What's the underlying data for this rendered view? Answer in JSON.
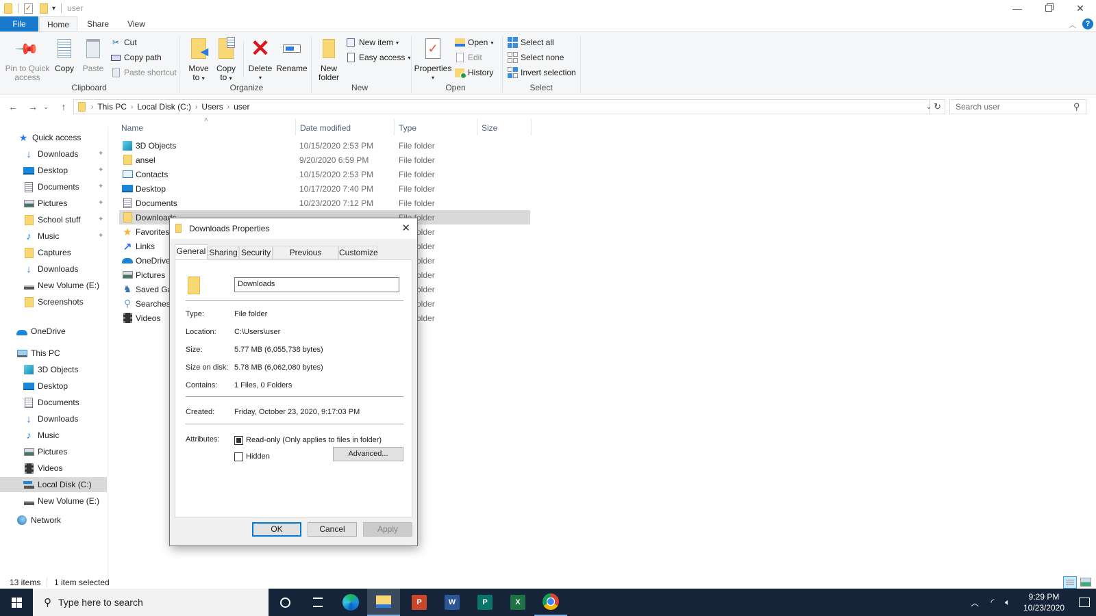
{
  "window": {
    "title": "user",
    "minimize_icon": "minimize-icon",
    "maximize_icon": "restore-icon",
    "close_icon": "close-icon"
  },
  "ribbon_tabs": [
    "File",
    "Home",
    "Share",
    "View"
  ],
  "ribbon": {
    "clipboard": {
      "label": "Clipboard",
      "pin": "Pin to Quick access",
      "pin_line1": "Pin to Quick",
      "pin_line2": "access",
      "copy": "Copy",
      "paste": "Paste",
      "cut": "Cut",
      "copy_path": "Copy path",
      "paste_shortcut": "Paste shortcut"
    },
    "organize": {
      "label": "Organize",
      "move_to_line1": "Move",
      "move_to_line2": "to",
      "copy_to_line1": "Copy",
      "copy_to_line2": "to",
      "delete": "Delete",
      "rename": "Rename"
    },
    "new": {
      "label": "New",
      "new_folder_line1": "New",
      "new_folder_line2": "folder",
      "new_item": "New item",
      "easy_access": "Easy access"
    },
    "open": {
      "label": "Open",
      "properties": "Properties",
      "open": "Open",
      "edit": "Edit",
      "history": "History"
    },
    "select": {
      "label": "Select",
      "select_all": "Select all",
      "select_none": "Select none",
      "invert_selection": "Invert selection"
    }
  },
  "address": {
    "crumbs": [
      "This PC",
      "Local Disk (C:)",
      "Users",
      "user"
    ],
    "search_placeholder": "Search user"
  },
  "sidebar": {
    "quick_access": "Quick access",
    "quick_items": [
      {
        "label": "Downloads",
        "icon": "download-arrow-icon",
        "pinned": true
      },
      {
        "label": "Desktop",
        "icon": "desktop-icon",
        "pinned": true
      },
      {
        "label": "Documents",
        "icon": "documents-icon",
        "pinned": true
      },
      {
        "label": "Pictures",
        "icon": "pictures-icon",
        "pinned": true
      },
      {
        "label": "School stuff",
        "icon": "folder-icon",
        "pinned": true
      },
      {
        "label": "Music",
        "icon": "music-icon",
        "pinned": true
      },
      {
        "label": "Captures",
        "icon": "folder-icon",
        "pinned": false
      },
      {
        "label": "Downloads",
        "icon": "download-arrow-icon",
        "pinned": false
      },
      {
        "label": "New Volume (E:)",
        "icon": "drive-icon",
        "pinned": false
      },
      {
        "label": "Screenshots",
        "icon": "folder-icon",
        "pinned": false
      }
    ],
    "onedrive": "OneDrive",
    "this_pc": "This PC",
    "pc_items": [
      {
        "label": "3D Objects",
        "icon": "3d-objects-icon"
      },
      {
        "label": "Desktop",
        "icon": "desktop-icon"
      },
      {
        "label": "Documents",
        "icon": "documents-icon"
      },
      {
        "label": "Downloads",
        "icon": "download-arrow-icon"
      },
      {
        "label": "Music",
        "icon": "music-icon"
      },
      {
        "label": "Pictures",
        "icon": "pictures-icon"
      },
      {
        "label": "Videos",
        "icon": "videos-icon"
      },
      {
        "label": "Local Disk (C:)",
        "icon": "system-drive-icon",
        "selected": true
      },
      {
        "label": "New Volume (E:)",
        "icon": "drive-icon"
      }
    ],
    "network": "Network"
  },
  "file_list": {
    "columns": [
      "Name",
      "Date modified",
      "Type",
      "Size"
    ],
    "rows": [
      {
        "name": "3D Objects",
        "date": "10/15/2020 2:53 PM",
        "type": "File folder",
        "icon": "3d-objects-icon"
      },
      {
        "name": "ansel",
        "date": "9/20/2020 6:59 PM",
        "type": "File folder",
        "icon": "folder-icon"
      },
      {
        "name": "Contacts",
        "date": "10/15/2020 2:53 PM",
        "type": "File folder",
        "icon": "contacts-icon"
      },
      {
        "name": "Desktop",
        "date": "10/17/2020 7:40 PM",
        "type": "File folder",
        "icon": "desktop-icon"
      },
      {
        "name": "Documents",
        "date": "10/23/2020 7:12 PM",
        "type": "File folder",
        "icon": "documents-icon"
      },
      {
        "name": "Downloads",
        "date": "",
        "type": "File folder",
        "icon": "folder-icon",
        "selected": true
      },
      {
        "name": "Favorites",
        "date": "",
        "type": "File folder",
        "icon": "favorites-star-icon"
      },
      {
        "name": "Links",
        "date": "",
        "type": "File folder",
        "icon": "links-icon"
      },
      {
        "name": "OneDrive",
        "date": "",
        "type": "File folder",
        "icon": "onedrive-cloud-icon"
      },
      {
        "name": "Pictures",
        "date": "",
        "type": "File folder",
        "icon": "pictures-icon"
      },
      {
        "name": "Saved Games",
        "date": "",
        "type": "File folder",
        "icon": "saved-games-icon"
      },
      {
        "name": "Searches",
        "date": "",
        "type": "File folder",
        "icon": "searches-icon"
      },
      {
        "name": "Videos",
        "date": "",
        "type": "File folder",
        "icon": "videos-icon"
      }
    ]
  },
  "status": {
    "item_count": "13 items",
    "selection": "1 item selected"
  },
  "dialog": {
    "title": "Downloads Properties",
    "tabs": [
      "General",
      "Sharing",
      "Security",
      "Previous Versions",
      "Customize"
    ],
    "active_tab": "General",
    "name_value": "Downloads",
    "type_label": "Type:",
    "type_value": "File folder",
    "location_label": "Location:",
    "location_value": "C:\\Users\\user",
    "size_label": "Size:",
    "size_value": "5.77 MB (6,055,738 bytes)",
    "size_on_disk_label": "Size on disk:",
    "size_on_disk_value": "5.78 MB (6,062,080 bytes)",
    "contains_label": "Contains:",
    "contains_value": "1 Files, 0 Folders",
    "created_label": "Created:",
    "created_value": "Friday, October 23, 2020, 9:17:03 PM",
    "attributes_label": "Attributes:",
    "readonly_label": "Read-only (Only applies to files in folder)",
    "readonly_state": "indeterminate",
    "hidden_label": "Hidden",
    "hidden_checked": false,
    "advanced_label": "Advanced...",
    "ok_label": "OK",
    "cancel_label": "Cancel",
    "apply_label": "Apply"
  },
  "taskbar": {
    "search_placeholder": "Type here to search",
    "apps": [
      "Cortana",
      "Task View",
      "Microsoft Edge",
      "File Explorer",
      "PowerPoint",
      "Word",
      "Publisher",
      "Excel",
      "Chrome"
    ],
    "time": "9:29 PM",
    "date": "10/23/2020"
  }
}
